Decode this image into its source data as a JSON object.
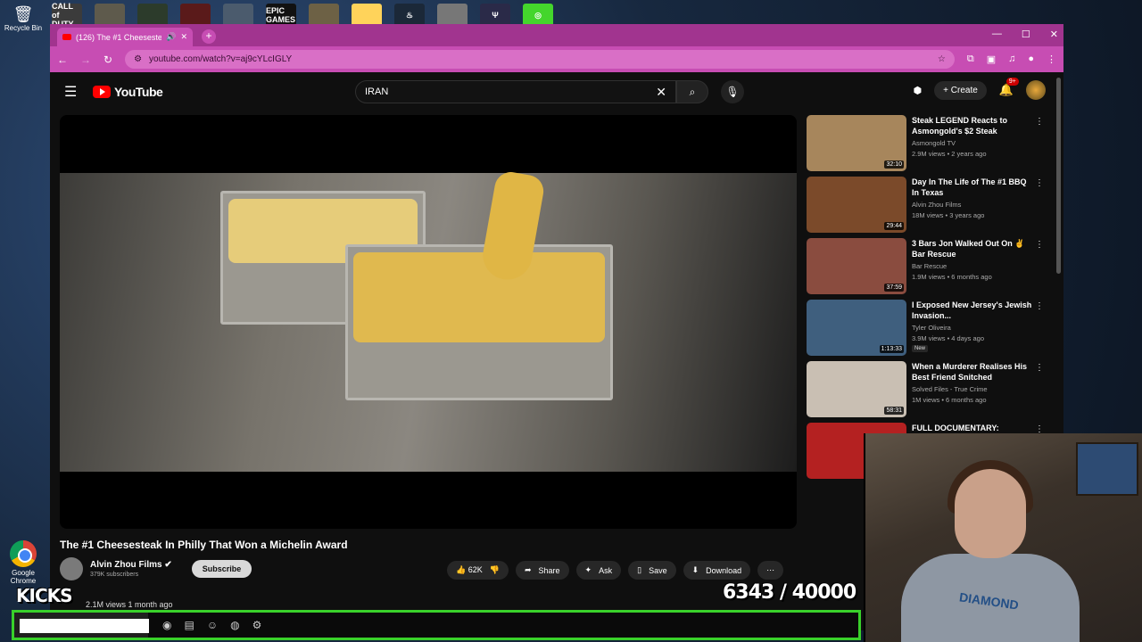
{
  "desktop": {
    "recycle_bin_label": "Recycle Bin",
    "chrome_label": "Google Chrome",
    "top_icons": [
      "CALL of DUTY",
      "",
      "",
      "",
      "",
      "EPIC GAMES",
      "",
      "",
      "",
      "",
      "",
      ""
    ]
  },
  "browser": {
    "tab_title": "(126) The #1 Cheesesteak In",
    "url": "youtube.com/watch?v=aj9cYLcIGLY"
  },
  "youtube": {
    "logo_text": "YouTube",
    "search_query": "IRAN",
    "create_label": "Create",
    "notification_badge": "9+"
  },
  "video": {
    "title": "The #1 Cheesesteak In Philly That Won a Michelin Award",
    "channel": "Alvin Zhou Films",
    "subscribers": "379K subscribers",
    "subscribe_label": "Subscribe",
    "likes": "62K",
    "share_label": "Share",
    "ask_label": "Ask",
    "save_label": "Save",
    "download_label": "Download",
    "views_line": "2.1M views  1 month ago"
  },
  "recommendations": [
    {
      "title": "Steak LEGEND Reacts to Asmongold's $2 Steak",
      "channel": "Asmongold TV",
      "meta": "2.9M views • 2 years ago",
      "duration": "32:10",
      "color": "#a7865c"
    },
    {
      "title": "Day In The Life of The #1 BBQ In Texas",
      "channel": "Alvin Zhou Films",
      "meta": "18M views • 3 years ago",
      "duration": "29:44",
      "color": "#7b4a2a"
    },
    {
      "title": "3 Bars Jon Walked Out On ✌ Bar Rescue",
      "channel": "Bar Rescue",
      "meta": "1.9M views • 6 months ago",
      "duration": "37:59",
      "color": "#8a4c3f"
    },
    {
      "title": "I Exposed New Jersey's Jewish Invasion...",
      "channel": "Tyler Oliveira",
      "meta": "3.9M views • 4 days ago",
      "duration": "1:13:33",
      "badge": "New",
      "color": "#3f5f7e"
    },
    {
      "title": "When a Murderer Realises His Best Friend Snitched",
      "channel": "Solved Files - True Crime",
      "meta": "1M views • 6 months ago",
      "duration": "58:31",
      "color": "#c9bfb3"
    },
    {
      "title": "FULL DOCUMENTARY:",
      "channel": "",
      "meta": "",
      "duration": "",
      "color": "#b42121"
    }
  ],
  "stream_overlay": {
    "label": "KICKS",
    "current": "6343",
    "goal": "40000",
    "progress": 0.158575
  },
  "webcam": {
    "shirt_text": "DIAMOND"
  }
}
